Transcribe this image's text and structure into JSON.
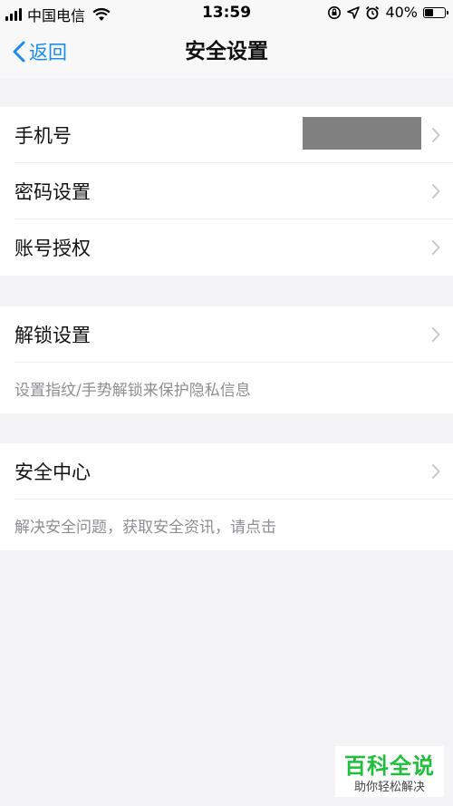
{
  "status_bar": {
    "carrier": "中国电信",
    "time": "13:59",
    "battery_percent": "40%",
    "battery_level": 0.4,
    "icons": [
      "signal-icon",
      "wifi-icon",
      "orientation-lock-icon",
      "location-icon",
      "alarm-icon",
      "battery-icon"
    ]
  },
  "nav": {
    "back_label": "返回",
    "title": "安全设置"
  },
  "groups": {
    "account": {
      "phone_label": "手机号",
      "password_label": "密码设置",
      "auth_label": "账号授权"
    },
    "unlock": {
      "label": "解锁设置",
      "description": "设置指纹/手势解锁来保护隐私信息"
    },
    "center": {
      "label": "安全中心",
      "description": "解决安全问题，获取安全资讯，请点击"
    }
  },
  "watermark": {
    "title": "百科全说",
    "subtitle": "助你轻松解决"
  },
  "colors": {
    "accent": "#1a8cf0",
    "background": "#f4f4f6",
    "row_background": "#ffffff",
    "secondary_text": "#8e8e93",
    "watermark_green": "#1fbf3c"
  }
}
